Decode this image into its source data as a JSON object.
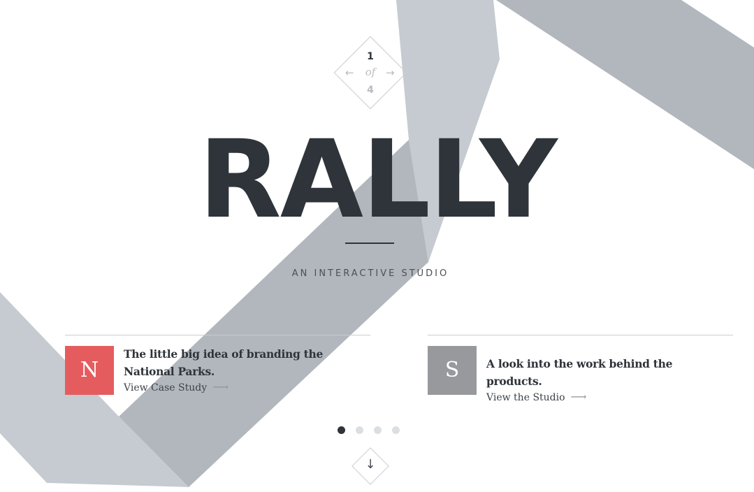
{
  "colors": {
    "ink": "#2e343a",
    "ribbon_light": "#c5cbd0",
    "ribbon_dark": "#b1b7bd",
    "badge_red": "#e55c5f",
    "badge_gray": "#97999c",
    "dot_active": "#2e343a",
    "dot_inactive": "#dcdfe2"
  },
  "slider": {
    "current": "1",
    "of_label": "of",
    "total": "4",
    "prev_icon": "←",
    "next_icon": "→"
  },
  "hero": {
    "title": "RALLY",
    "tagline": "AN INTERACTIVE STUDIO"
  },
  "cards": [
    {
      "badge_letter": "N",
      "badge_color": "#e55c5f",
      "heading": "The little big idea of branding the National Parks.",
      "link_label": "View Case Study",
      "link_icon": "⟶"
    },
    {
      "badge_letter": "S",
      "badge_color": "#97999c",
      "heading": "A look into the work behind the products.",
      "link_label": "View the Studio",
      "link_icon": "⟶"
    }
  ],
  "pager": {
    "active_index": 0,
    "count": 4
  },
  "scroll_down": {
    "icon": "↓"
  }
}
